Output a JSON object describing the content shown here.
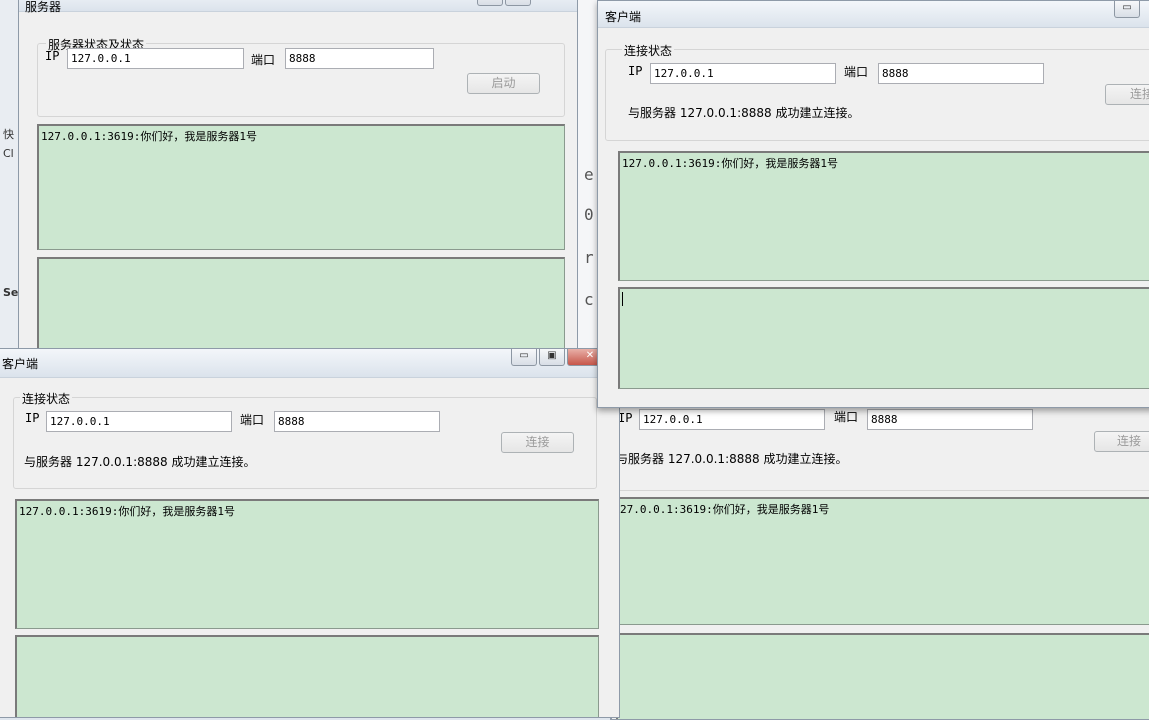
{
  "server": {
    "title": "服务器",
    "group_label": "服务器状态及状态",
    "ip_label": "IP",
    "ip_value": "127.0.0.1",
    "port_label": "端口",
    "port_value": "8888",
    "start_button": "启动",
    "log_text": "127.0.0.1:3619:你们好，我是服务器1号"
  },
  "client_a": {
    "title": "客户端",
    "group_label": "连接状态",
    "ip_label": "IP",
    "ip_value": "127.0.0.1",
    "port_label": "端口",
    "port_value": "8888",
    "connect_button": "连接",
    "status_text": "与服务器 127.0.0.1:8888 成功建立连接。",
    "log_text": "127.0.0.1:3619:你们好，我是服务器1号"
  },
  "client_b": {
    "title": "客户端",
    "group_label": "连接状态",
    "ip_label": "IP",
    "ip_value": "127.0.0.1",
    "port_label": "端口",
    "port_value": "8888",
    "connect_button": "连接",
    "status_text": "与服务器 127.0.0.1:8888 成功建立连接。",
    "log_text": "127.0.0.1:3619:你们好，我是服务器1号"
  },
  "client_c": {
    "ip_label": "IP",
    "ip_value": "127.0.0.1",
    "port_label": "端口",
    "port_value": "8888",
    "connect_button": "连接",
    "status_text": "与服务器 127.0.0.1:8888 成功建立连接。",
    "log_text": "27.0.0.1:3619:你们好，我是服务器1号"
  },
  "ide": {
    "glyphs": [
      "快",
      "Cl",
      "Se"
    ],
    "code_letters": [
      "e",
      "0",
      "r",
      "c"
    ]
  },
  "window_controls": {
    "minimize": "▭",
    "restore": "▣",
    "close": "✕"
  }
}
